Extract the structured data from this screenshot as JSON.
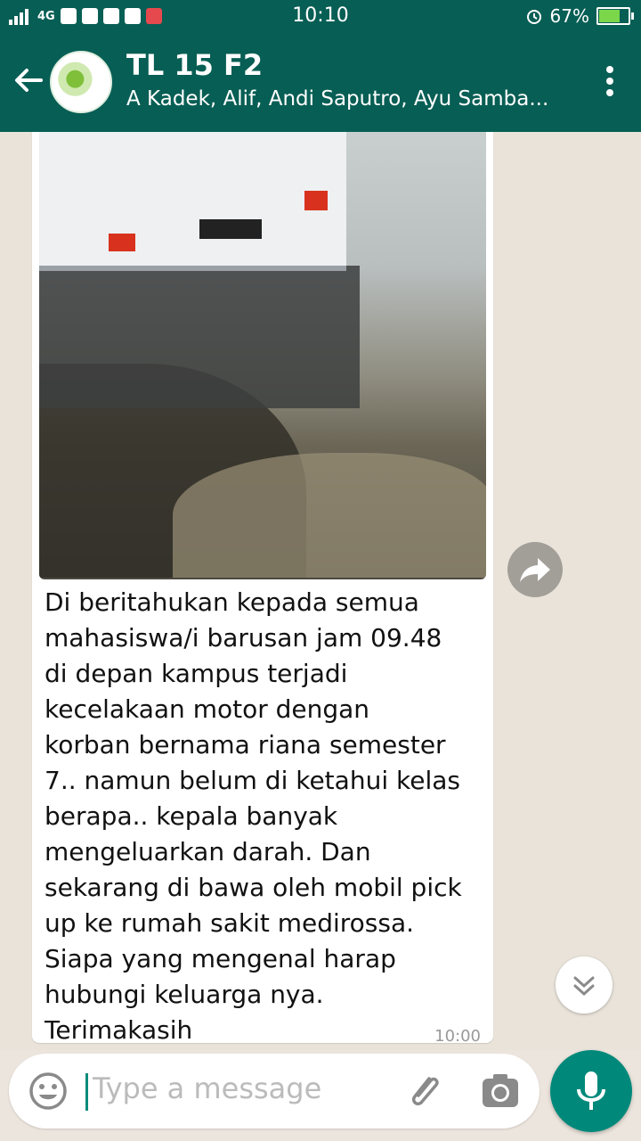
{
  "status_bar": {
    "time": "10:10",
    "network": "4G",
    "battery_percent": "67%",
    "battery_level": 0.67
  },
  "header": {
    "title": "TL 15 F2",
    "members": "A Kadek, Alif, Andi Saputro, Ayu Samba..."
  },
  "message": {
    "text": "Di beritahukan kepada semua\nmahasiswa/i barusan jam 09.48\ndi depan kampus terjadi\nkecelakaan motor dengan\nkorban bernama riana semester\n7.. namun belum di ketahui kelas\nberapa.. kepala banyak\nmengeluarkan darah. Dan\nsekarang di bawa oleh mobil pick\nup ke rumah sakit medirossa.\nSiapa yang mengenal  harap\nhubungi keluarga nya.\nTerimakasih",
    "time": "10:00"
  },
  "composer": {
    "placeholder": "Type a message"
  },
  "icons": {
    "back": "arrow-left-icon",
    "menu": "more-vert-icon",
    "forward": "forward-icon",
    "scroll": "chevron-down-icon",
    "emoji": "emoji-icon",
    "attach": "paperclip-icon",
    "camera": "camera-icon",
    "mic": "microphone-icon"
  },
  "colors": {
    "header": "#075e54",
    "accent": "#00897b",
    "battery": "#7bd64a"
  }
}
